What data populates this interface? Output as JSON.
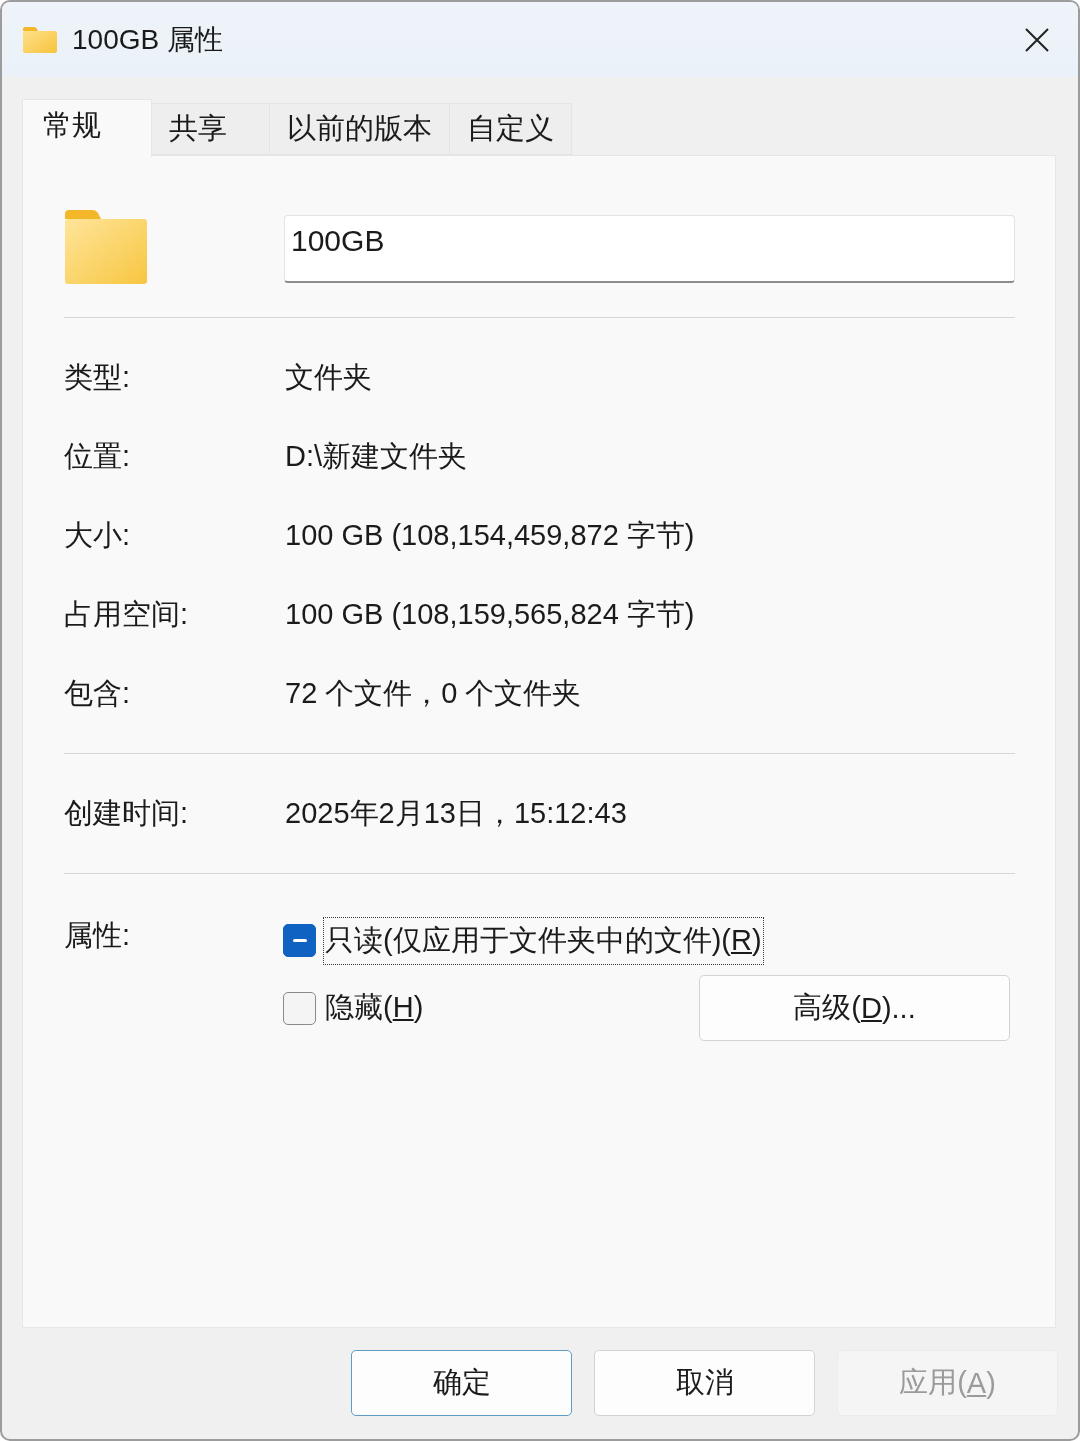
{
  "window": {
    "title": "100GB 属性"
  },
  "tabs": [
    {
      "label": "常规",
      "selected": true
    },
    {
      "label": "共享",
      "selected": false
    },
    {
      "label": "以前的版本",
      "selected": false
    },
    {
      "label": "自定义",
      "selected": false
    }
  ],
  "name_field": {
    "value": "100GB"
  },
  "sections": [
    {
      "rows": [
        {
          "label": "类型:",
          "value": "文件夹"
        },
        {
          "label": "位置:",
          "value": "D:\\新建文件夹"
        },
        {
          "label": "大小:",
          "value": "100 GB (108,154,459,872 字节)"
        },
        {
          "label": "占用空间:",
          "value": "100 GB (108,159,565,824 字节)"
        },
        {
          "label": "包含:",
          "value": "72 个文件，0 个文件夹"
        }
      ]
    },
    {
      "rows": [
        {
          "label": "创建时间:",
          "value": "2025年2月13日，15:12:43"
        }
      ]
    }
  ],
  "attributes": {
    "label": "属性:",
    "checkboxes": [
      {
        "label": {
          "text": "只读(仅应用于文件夹中的文件)(",
          "access_key": "R",
          "text_after": ")"
        },
        "checked": true,
        "mixed": true,
        "focused": true
      },
      {
        "label": {
          "text": "隐藏(",
          "access_key": "H",
          "text_after": ")"
        },
        "checked": false,
        "mixed": false,
        "focused": false
      }
    ],
    "advanced_button": {
      "label": {
        "text": "高级(",
        "access_key": "D",
        "text_after": ")..."
      }
    }
  },
  "buttons": [
    {
      "label": {
        "text": "确定"
      },
      "default": true,
      "disabled": false
    },
    {
      "label": {
        "text": "取消"
      },
      "default": false,
      "disabled": false
    },
    {
      "label": {
        "text": "应用(",
        "access_key": "A",
        "text_after": ")"
      },
      "default": false,
      "disabled": true
    }
  ]
}
